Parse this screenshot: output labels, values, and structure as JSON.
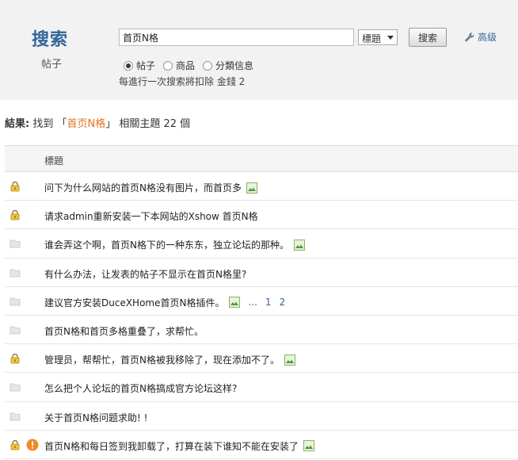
{
  "search": {
    "title": "搜索",
    "subtitle": "帖子",
    "keyword": "首页N格",
    "type_selected": "標題",
    "button_label": "搜索",
    "advanced_label": "高级",
    "scopes": [
      {
        "label": "帖子",
        "checked": true
      },
      {
        "label": "商品",
        "checked": false
      },
      {
        "label": "分類信息",
        "checked": false
      }
    ],
    "cost_note": "每進行一次搜索將扣除 金錢 2"
  },
  "result": {
    "label": "結果:",
    "prefix": "找到 「",
    "keyword": "首页N格",
    "suffix": "」 相關主題 22 個"
  },
  "table": {
    "header": "標題",
    "rows": [
      {
        "title": "问下为什么网站的首页N格没有图片，而首页多",
        "icon": "lock-icon",
        "has_image": true,
        "warning": false,
        "pages": []
      },
      {
        "title": "请求admin重新安装一下本网站的Xshow 首页N格",
        "icon": "lock-icon",
        "has_image": false,
        "warning": false,
        "pages": []
      },
      {
        "title": "谁会弄这个啊，首页N格下的一种东东，独立论坛的那种。",
        "icon": "folder-icon",
        "has_image": true,
        "warning": false,
        "pages": []
      },
      {
        "title": "有什么办法，让发表的帖子不显示在首页N格里?",
        "icon": "folder-icon",
        "has_image": false,
        "warning": false,
        "pages": []
      },
      {
        "title": "建议官方安装DuceXHome首页N格插件。",
        "icon": "folder-icon",
        "has_image": true,
        "warning": false,
        "pages": [
          "...",
          "1",
          "2"
        ]
      },
      {
        "title": "首页N格和首页多格重叠了，求帮忙。",
        "icon": "folder-icon",
        "has_image": false,
        "warning": false,
        "pages": []
      },
      {
        "title": "管理员，帮帮忙，首页N格被我移除了，现在添加不了。",
        "icon": "lock-icon",
        "has_image": true,
        "warning": false,
        "pages": []
      },
      {
        "title": "怎么把个人论坛的首页N格搞成官方论坛这样?",
        "icon": "folder-icon",
        "has_image": false,
        "warning": false,
        "pages": []
      },
      {
        "title": "关于首页N格问题求助! !",
        "icon": "folder-icon",
        "has_image": false,
        "warning": false,
        "pages": []
      },
      {
        "title": "首页N格和每日签到我卸载了，打算在装下谁知不能在安装了",
        "icon": "lock-icon",
        "has_image": true,
        "warning": true,
        "pages": []
      }
    ]
  },
  "colors": {
    "accent": "#336699",
    "highlight": "#e2731f",
    "panel_bg": "#f2f2f2"
  }
}
